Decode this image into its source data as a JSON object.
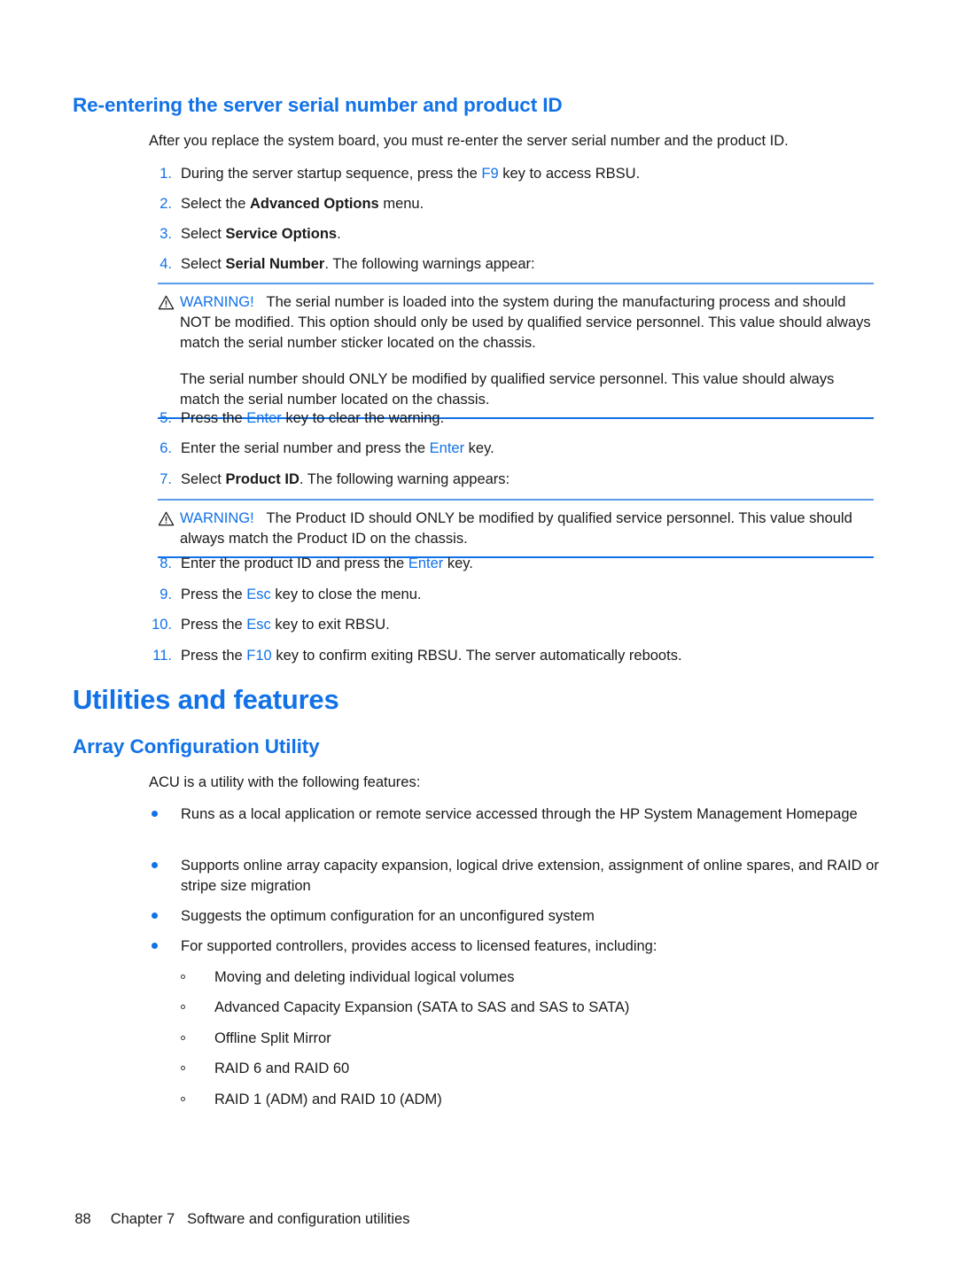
{
  "document": {
    "section_heading": "Re-entering the server serial number and product ID",
    "intro_paragraph": "After you replace the system board, you must re-enter the server serial number and the product ID.",
    "chapter_heading": "Utilities and features",
    "subsection_heading": "Array Configuration Utility",
    "acu_intro": "ACU is a utility with the following features:"
  },
  "steps": [
    {
      "number": "1.",
      "pre": "During the server startup sequence, press the ",
      "key": "F9",
      "post": " key to access RBSU."
    },
    {
      "number": "2.",
      "pre": "Select the ",
      "bold": "Advanced Options",
      "post": " menu."
    },
    {
      "number": "3.",
      "pre": "Select ",
      "bold": "Service Options",
      "post": "."
    },
    {
      "number": "4.",
      "pre": "Select ",
      "bold": "Serial Number",
      "post": ". The following warnings appear:"
    },
    {
      "number": "5.",
      "pre": "Press the ",
      "key": "Enter",
      "post": " key to clear the warning."
    },
    {
      "number": "6.",
      "pre": "Enter the serial number and press the ",
      "key": "Enter",
      "post": " key."
    },
    {
      "number": "7.",
      "pre": "Select ",
      "bold": "Product ID",
      "post": ". The following warning appears:"
    },
    {
      "number": "8.",
      "pre": "Enter the product ID and press the ",
      "key": "Enter",
      "post": " key."
    },
    {
      "number": "9.",
      "pre": "Press the ",
      "key": "Esc",
      "post": " key to close the menu."
    },
    {
      "number": "10.",
      "pre": "Press the ",
      "key": "Esc",
      "post": " key to exit RBSU."
    },
    {
      "number": "11.",
      "pre": "Press the ",
      "key": "F10",
      "post": " key to confirm exiting RBSU. The server automatically reboots."
    }
  ],
  "warnings": [
    {
      "label": "WARNING!",
      "icon": "warning-triangle-icon",
      "paragraph1": "The serial number is loaded into the system during the manufacturing process and should NOT be modified. This option should only be used by qualified service personnel. This value should always match the serial number sticker located on the chassis.",
      "paragraph2": "The serial number should ONLY be modified by qualified service personnel. This value should always match the serial number located on the chassis."
    },
    {
      "label": "WARNING!",
      "icon": "warning-triangle-icon",
      "paragraph1": "The Product ID should ONLY be modified by qualified service personnel. This value should always match the Product ID on the chassis.",
      "paragraph2": ""
    }
  ],
  "features": [
    "Runs as a local application or remote service accessed through the HP System Management Homepage",
    "Supports online array capacity expansion, logical drive extension, assignment of online spares, and RAID or stripe size migration",
    "Suggests the optimum configuration for an unconfigured system",
    "For supported controllers, provides access to licensed features, including:"
  ],
  "sub_features": [
    "Moving and deleting individual logical volumes",
    "Advanced Capacity Expansion (SATA to SAS and SAS to SATA)",
    "Offline Split Mirror",
    "RAID 6 and RAID 60",
    "RAID 1 (ADM) and RAID 10 (ADM)"
  ],
  "footer": {
    "page_number": "88",
    "chapter": "Chapter 7",
    "title": "Software and configuration utilities"
  },
  "colors": {
    "accent_blue": "#1172e8",
    "rule_light": "#5b9bea",
    "rule_dark": "#1172e8",
    "text": "#1a1a1a"
  }
}
